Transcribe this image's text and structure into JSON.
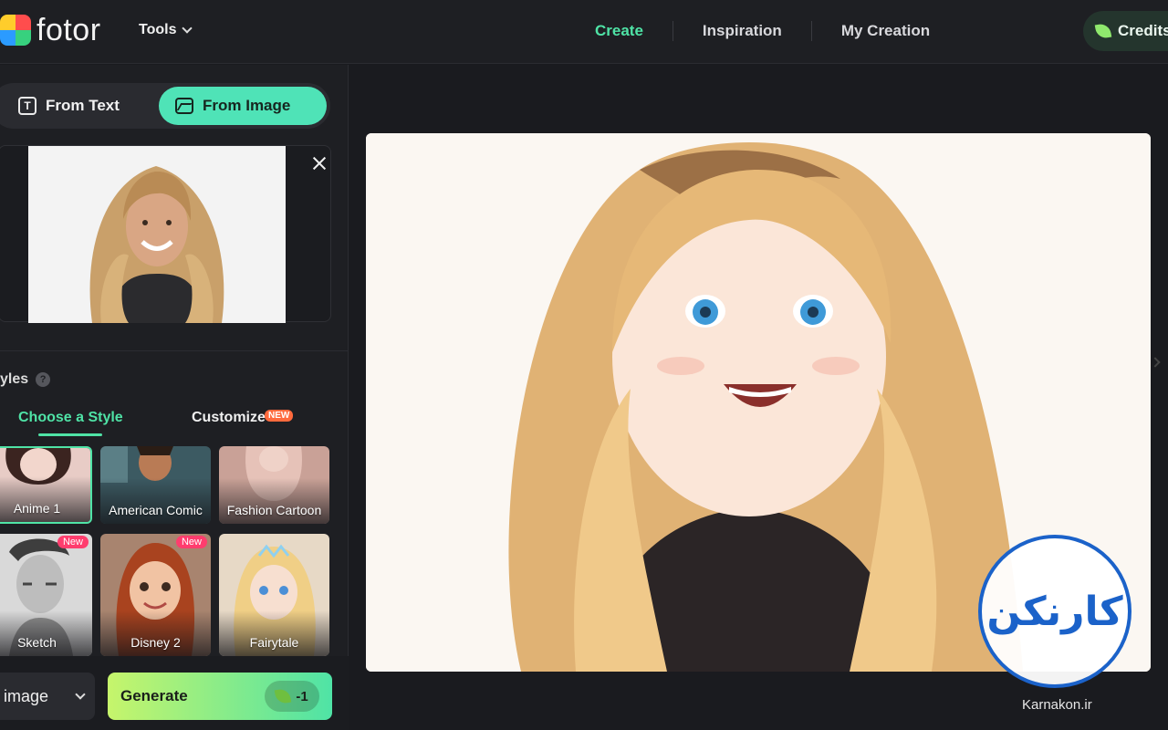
{
  "app": {
    "brand": "fotor"
  },
  "header": {
    "tools_label": "Tools",
    "nav": [
      {
        "label": "Create",
        "active": true
      },
      {
        "label": "Inspiration",
        "active": false
      },
      {
        "label": "My Creation",
        "active": false
      }
    ],
    "credits_label": "Credits"
  },
  "mode": {
    "from_text": "From Text",
    "from_image": "From Image",
    "selected": "From Image"
  },
  "styles": {
    "title": "yles",
    "tabs": {
      "choose": "Choose a Style",
      "customize": "Customize",
      "new_badge": "NEW"
    },
    "cards": [
      {
        "label": "Anime 1",
        "selected": true,
        "new": false
      },
      {
        "label": "American Comic",
        "selected": false,
        "new": false
      },
      {
        "label": "Fashion Cartoon",
        "selected": false,
        "new": false
      },
      {
        "label": "Sketch",
        "selected": false,
        "new": true
      },
      {
        "label": "Disney 2",
        "selected": false,
        "new": true
      },
      {
        "label": "Fairytale",
        "selected": false,
        "new": false
      }
    ],
    "new_label": "New"
  },
  "bottom": {
    "select_value": "image",
    "generate_label": "Generate",
    "cost": "-1"
  },
  "watermark": {
    "text": "Karnakon.ir",
    "logo_text": "کارنکن"
  },
  "colors": {
    "accent": "#4fe3a6",
    "generate_from": "#c6f56b",
    "generate_to": "#4fe3a6",
    "new_badge": "#ff3d6e",
    "watermark_blue": "#1b62c9"
  }
}
